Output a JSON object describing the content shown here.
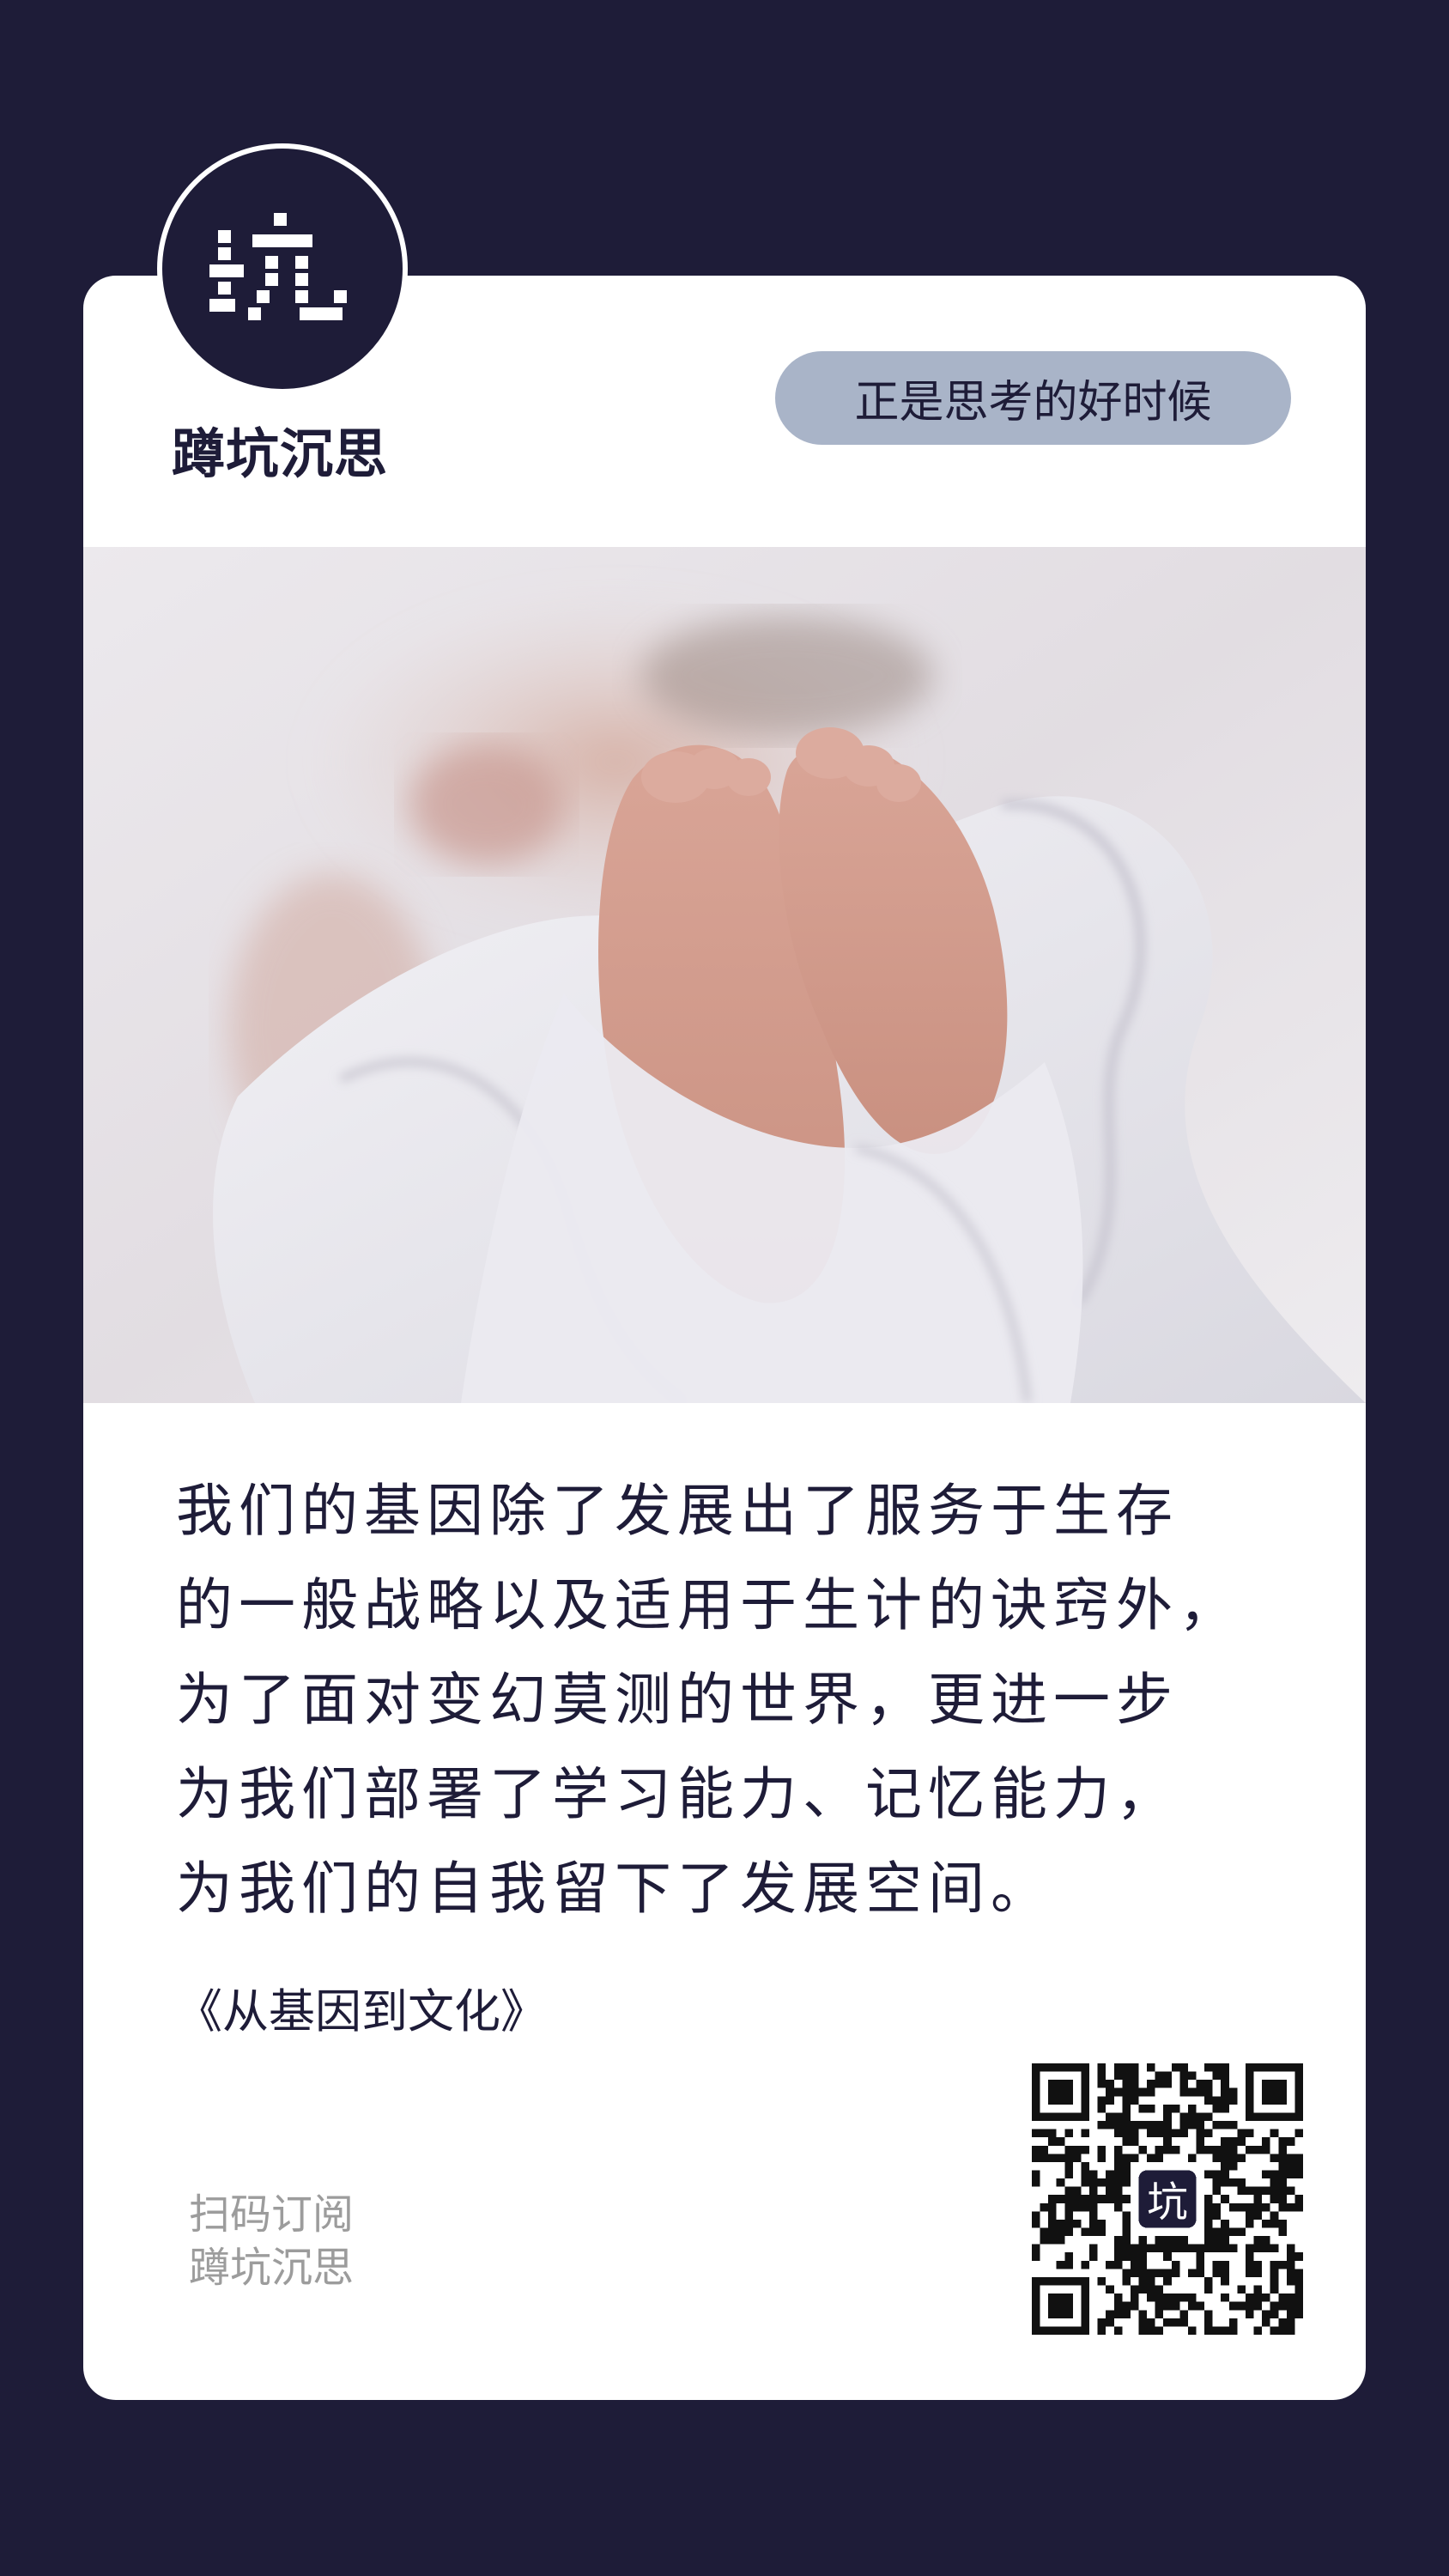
{
  "brand": {
    "logo_glyph": "坑",
    "name": "蹲坑沉思",
    "tagline": "正是思考的好时候"
  },
  "quote": {
    "lines": [
      "我们的基因除了发展出了服务于生存",
      "的一般战略以及适用于生计的诀窍外，",
      "为了面对变幻莫测的世界，更进一步",
      "为我们部署了学习能力、记忆能力，",
      "为我们的自我留下了发展空间。"
    ],
    "source": "《从基因到文化》"
  },
  "footer": {
    "scan_line1": "扫码订阅",
    "scan_line2": "蹲坑沉思",
    "qr_center_glyph": "坑"
  },
  "colors": {
    "background": "#1e1c38",
    "card": "#ffffff",
    "tagline_pill": "#a9b4c8",
    "muted_text": "#9c9c9c"
  }
}
